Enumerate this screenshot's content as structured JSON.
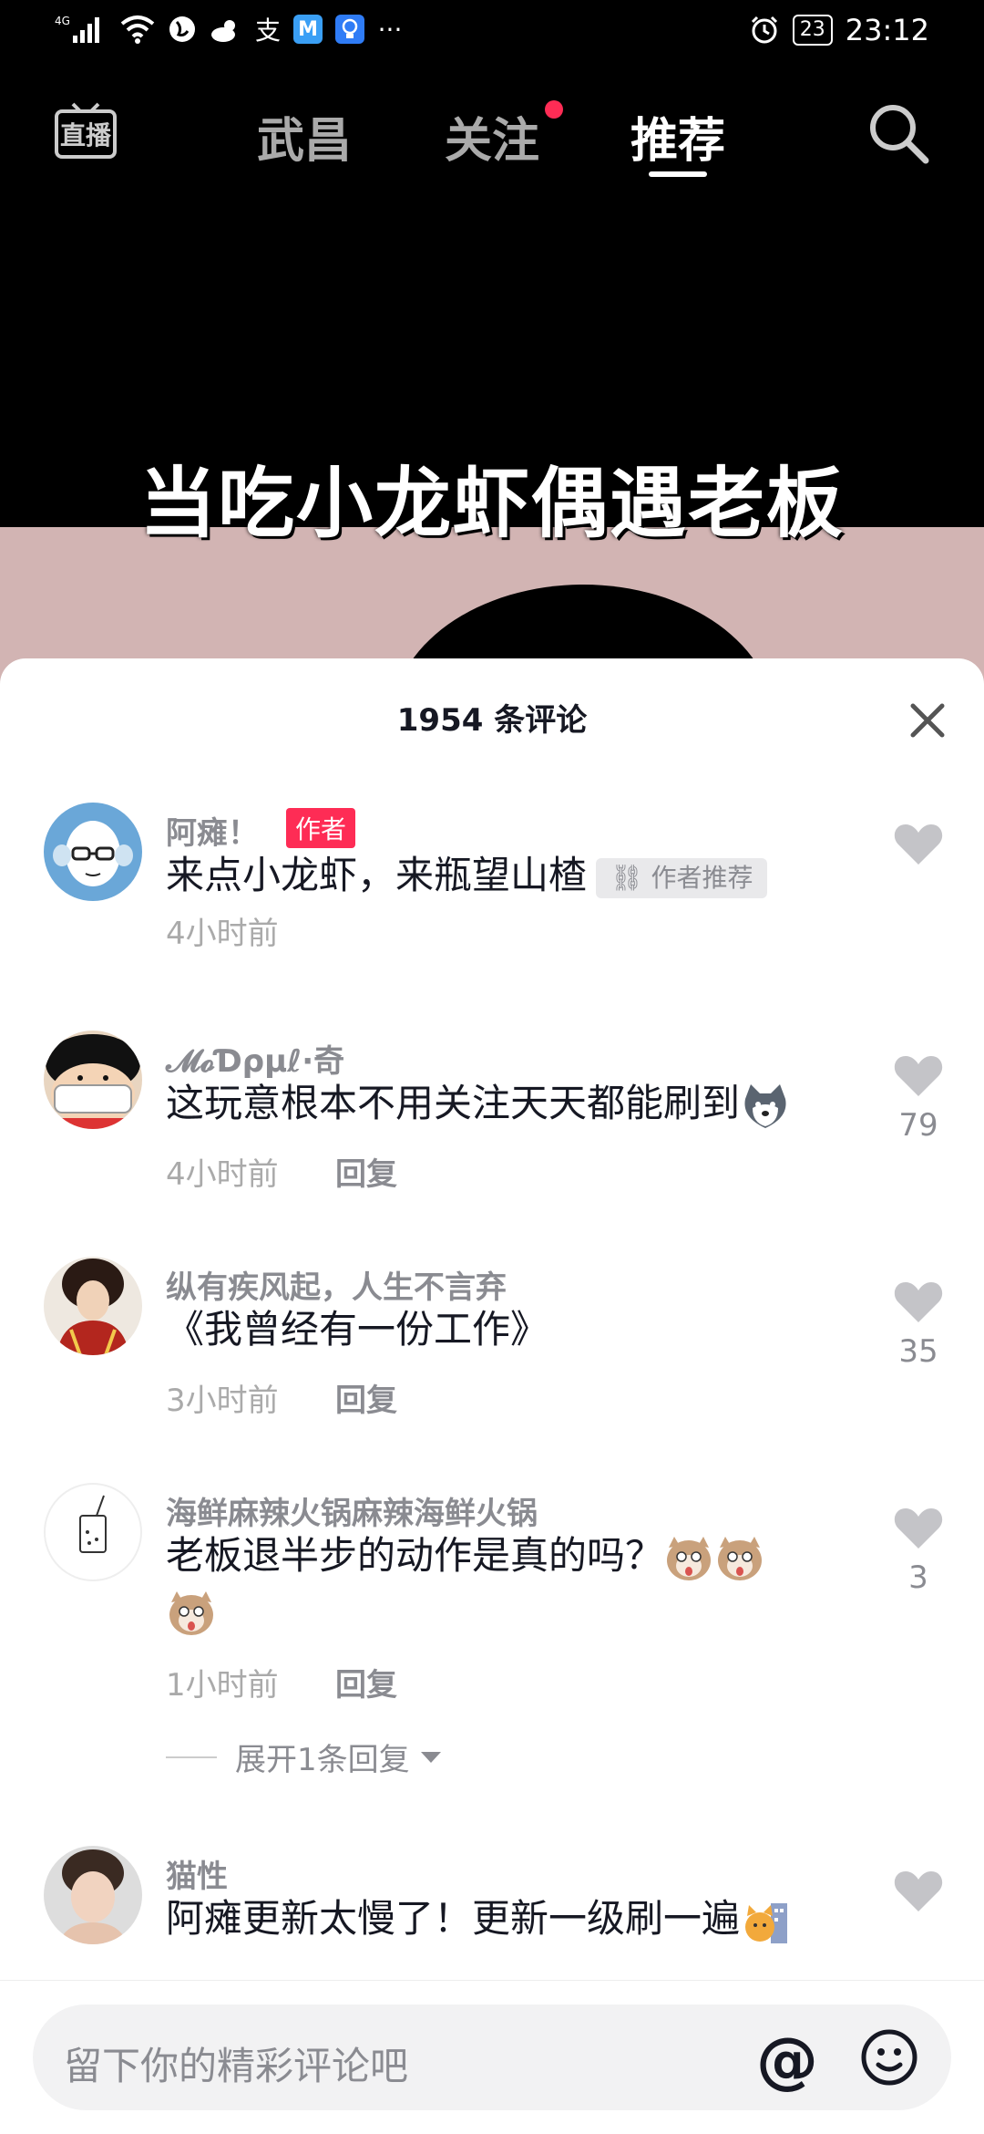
{
  "status_bar": {
    "signal": "4G",
    "alipay_glyph": "支",
    "more": "···",
    "battery": "23",
    "time": "23:12",
    "icons": [
      "signal-icon",
      "wifi-icon",
      "globe-icon",
      "weather-icon",
      "alipay-icon",
      "app-m-icon",
      "bulb-icon",
      "more-icon",
      "alarm-icon",
      "battery-icon"
    ]
  },
  "nav": {
    "live_label": "直播",
    "tabs": [
      {
        "label": "武昌"
      },
      {
        "label": "关注"
      },
      {
        "label": "推荐"
      }
    ],
    "active_tab": "推荐",
    "accent": "#fe2c55"
  },
  "video": {
    "title": "当吃小龙虾偶遇老板"
  },
  "comments_panel": {
    "title": "1954 条评论",
    "comments": [
      {
        "user": "阿瘫！",
        "author_badge": "作者",
        "text": "来点小龙虾，来瓶望山楂",
        "tag": "作者推荐",
        "time": "4小时前"
      },
      {
        "user": "𝓜𝓸Ɗρμℓ·奇",
        "text": "这玩意根本不用关注天天都能刷到",
        "time": "4小时前",
        "reply": "回复",
        "likes": "79"
      },
      {
        "user": "纵有疾风起，人生不言弃",
        "text": "《我曾经有一份工作》",
        "time": "3小时前",
        "reply": "回复",
        "likes": "35"
      },
      {
        "user": "海鲜麻辣火锅麻辣海鲜火锅",
        "text": "老板退半步的动作是真的吗？",
        "time": "1小时前",
        "reply": "回复",
        "likes": "3",
        "expand": "展开1条回复"
      },
      {
        "user": "猫性",
        "text": "阿瘫更新太慢了！更新一级刷一遍"
      }
    ]
  },
  "input": {
    "placeholder": "留下你的精彩评论吧",
    "at": "@"
  }
}
